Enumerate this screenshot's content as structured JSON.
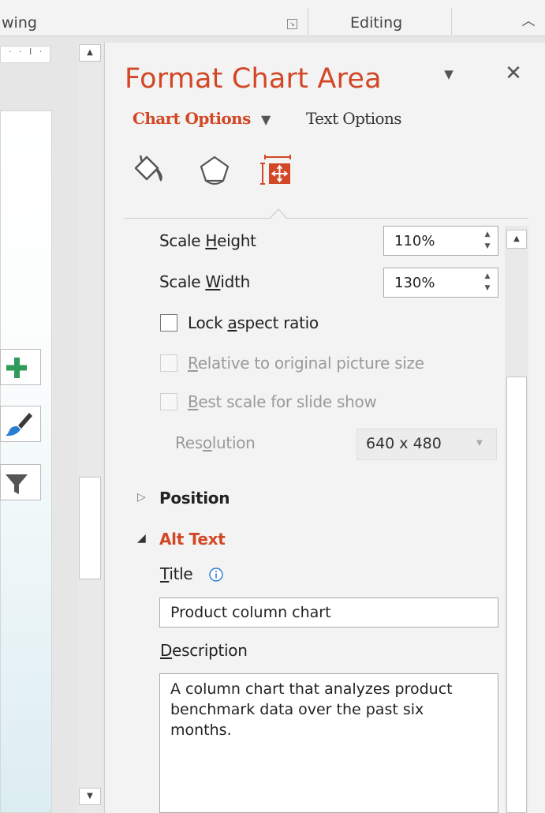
{
  "ribbon": {
    "drawing_group": "wing",
    "editing_group": "Editing"
  },
  "ruler": {
    "marks": "· · I ·"
  },
  "pane": {
    "title": "Format Chart Area",
    "tabs": {
      "chart_options": "Chart Options",
      "text_options": "Text Options"
    },
    "size": {
      "scale_height": {
        "label_pre": "Scale ",
        "label_key": "H",
        "label_post": "eight",
        "value": "110%"
      },
      "scale_width": {
        "label_pre": "Scale ",
        "label_key": "W",
        "label_post": "idth",
        "value": "130%"
      },
      "lock_aspect": {
        "label_pre": "Lock ",
        "label_key": "a",
        "label_post": "spect ratio",
        "checked": false
      },
      "relative_original": {
        "label_key": "R",
        "label_post": "elative to original picture size",
        "checked": false,
        "enabled": false
      },
      "best_scale": {
        "label_key": "B",
        "label_post": "est scale for slide show",
        "checked": false,
        "enabled": false
      },
      "resolution": {
        "label_pre": "Res",
        "label_key": "o",
        "label_post": "lution",
        "value": "640 x 480"
      }
    },
    "sections": {
      "position": "Position",
      "alt_text": "Alt Text"
    },
    "alt_text": {
      "title_label_key": "T",
      "title_label_post": "itle",
      "title_value": "Product column chart",
      "description_label_key": "D",
      "description_label_post": "escription",
      "description_value": "A column chart that analyzes product benchmark data over the past six months."
    }
  },
  "colors": {
    "accent": "#d24726",
    "chart_elements_plus": "#2e9b5a",
    "pane_bg": "#f3f3f3"
  },
  "icons": {
    "fill_line": "paint-bucket-icon",
    "effects": "pentagon-icon",
    "size_properties": "size-properties-icon",
    "info": "info-icon",
    "chart_elements": "plus-icon",
    "chart_styles": "brush-icon",
    "chart_filters": "filter-icon"
  }
}
